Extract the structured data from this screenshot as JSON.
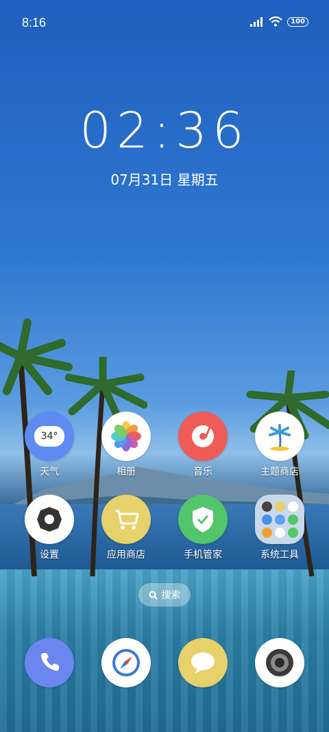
{
  "status": {
    "time": "8:16",
    "battery": "100"
  },
  "clock": {
    "time": "02:36",
    "date": "07月31日  星期五"
  },
  "apps_row1": [
    {
      "label": "天气",
      "icon": "weather-icon",
      "temp": "34°",
      "color": "#5f8af2"
    },
    {
      "label": "相册",
      "icon": "photos-icon",
      "color": "#ffffff"
    },
    {
      "label": "音乐",
      "icon": "music-icon",
      "color": "#ef5b57"
    },
    {
      "label": "主题商店",
      "icon": "theme-store-icon",
      "color": "#ffffff"
    }
  ],
  "apps_row2": [
    {
      "label": "设置",
      "icon": "settings-icon",
      "color": "#ffffff"
    },
    {
      "label": "应用商店",
      "icon": "app-store-icon",
      "color": "#e6d16a"
    },
    {
      "label": "手机管家",
      "icon": "phone-manager-icon",
      "color": "#53c56b"
    },
    {
      "label": "系统工具",
      "icon": "system-tools-folder-icon",
      "color": "#c9d9ea"
    }
  ],
  "search": {
    "label": "搜索"
  },
  "dock": [
    {
      "icon": "phone-icon",
      "color": "#6b86ef"
    },
    {
      "icon": "browser-icon",
      "color": "#ffffff"
    },
    {
      "icon": "messages-icon",
      "color": "#e6d16a"
    },
    {
      "icon": "camera-icon",
      "color": "#ffffff"
    }
  ]
}
